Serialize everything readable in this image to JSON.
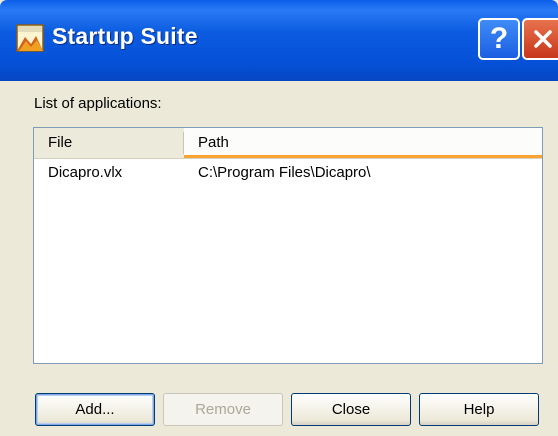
{
  "window": {
    "title": "Startup Suite",
    "title_buttons": {
      "help": "?",
      "close": "close"
    }
  },
  "list_label": "List of applications:",
  "list": {
    "columns": [
      "File",
      "Path"
    ],
    "rows": [
      {
        "file": "Dicapro.vlx",
        "path": "C:\\Program Files\\Dicapro\\"
      }
    ]
  },
  "buttons": {
    "add": "Add...",
    "remove": "Remove",
    "close": "Close",
    "help": "Help"
  },
  "colors": {
    "titlebar": "#0550d6",
    "accent_sort_column": "#f8a332",
    "dialog_bg": "#ece9d8"
  },
  "icons": {
    "app": "startup-suite-app-icon",
    "help": "help-question-icon",
    "close": "close-x-icon"
  }
}
